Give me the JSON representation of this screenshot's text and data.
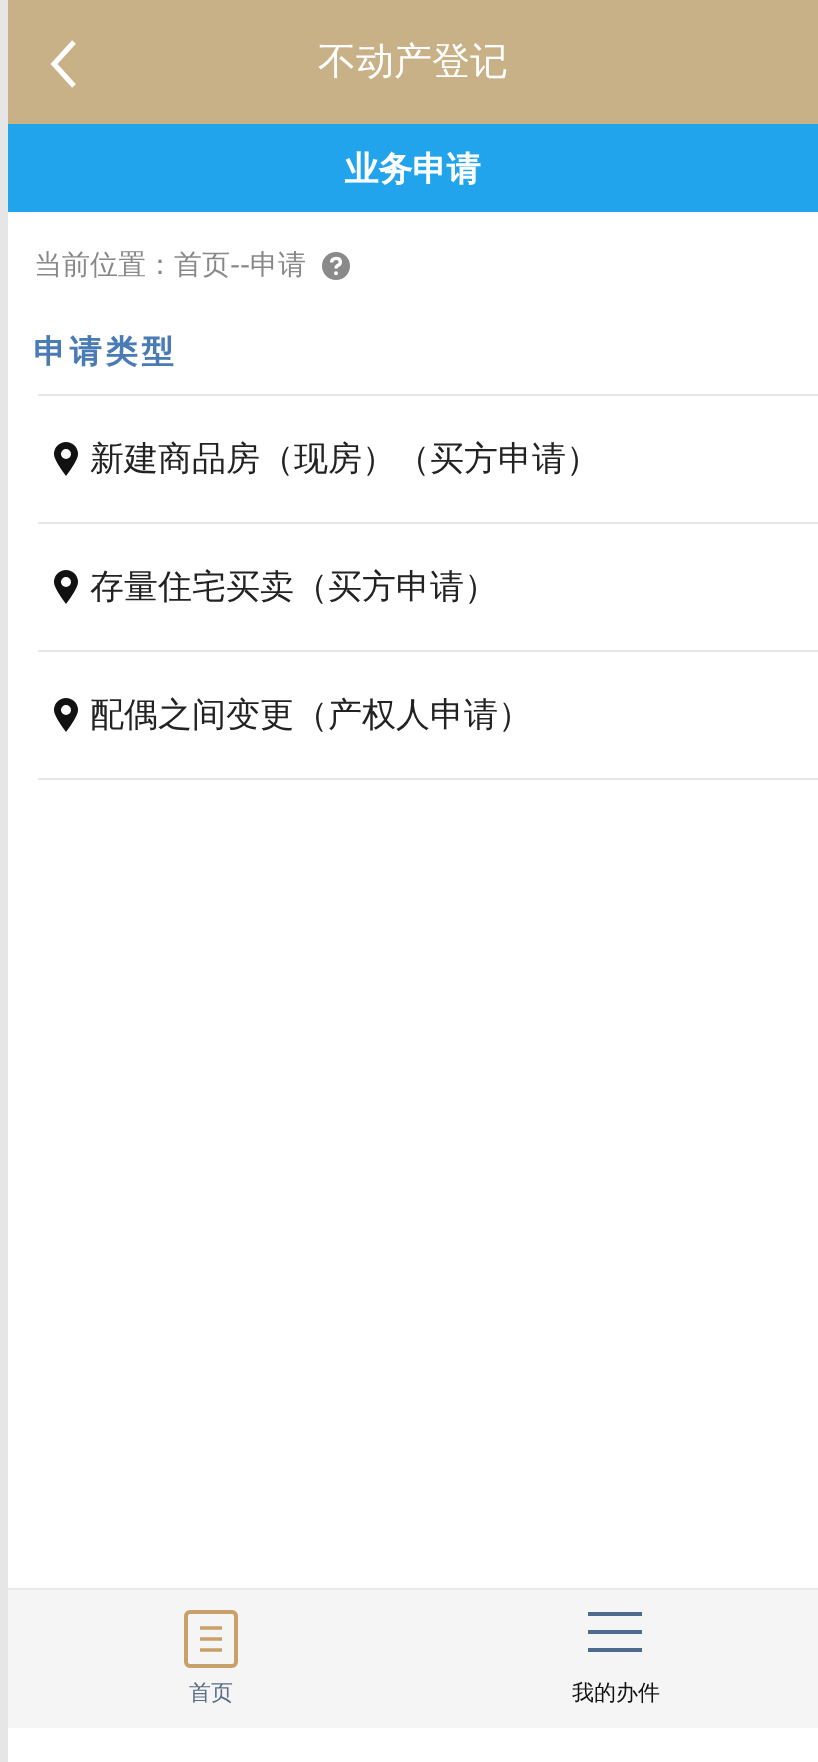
{
  "header": {
    "title": "不动产登记"
  },
  "subheader": {
    "title": "业务申请"
  },
  "breadcrumb": {
    "text": "当前位置：首页--申请"
  },
  "section": {
    "title": "申请类型"
  },
  "items": [
    {
      "label": "新建商品房（现房）（买方申请）"
    },
    {
      "label": "存量住宅买卖（买方申请）"
    },
    {
      "label": "配偶之间变更（产权人申请）"
    }
  ],
  "tabs": [
    {
      "label": "首页",
      "kind": "home",
      "selected": true
    },
    {
      "label": "我的办件",
      "kind": "list",
      "selected": false
    }
  ]
}
